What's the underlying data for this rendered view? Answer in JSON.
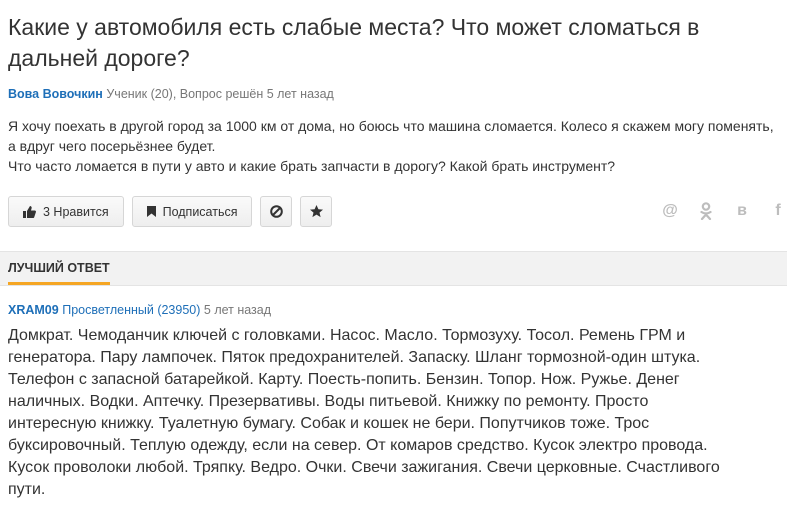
{
  "question": {
    "title": "Какие у автомобиля есть слабые места? Что может сломаться в дальней дороге?",
    "author": "Вова Вовочкин",
    "meta": "Ученик (20), Вопрос решён 5 лет назад",
    "body_line1": "Я хочу поехать в другой город за 1000 км от дома, но боюсь что машина сломается. Колесо я скажем могу поменять, а вдруг чего посерьёзнее будет.",
    "body_line2": "Что часто ломается в пути у авто и какие брать запчасти в дорогу? Какой брать инструмент?"
  },
  "actions": {
    "like_label": "3 Нравится",
    "subscribe_label": "Подписаться",
    "block_icon": "block-icon",
    "star_icon": "star-icon"
  },
  "share": {
    "icons": [
      "mail-ru-icon",
      "odnoklassniki-icon",
      "vk-icon",
      "facebook-icon"
    ]
  },
  "best_answer": {
    "label": "ЛУЧШИЙ ОТВЕТ",
    "author": "XRAM09",
    "rank": "Просветленный (23950)",
    "time": "5 лет назад",
    "body": "Домкрат. Чемоданчик ключей с головками. Насос. Масло. Тормозуху. Тосол. Ремень ГРМ и генератора. Пару лампочек. Пяток предохранителей. Запаску. Шланг тормозной-один штука. Телефон с запасной батарейкой. Карту. Поесть-попить. Бензин. Топор. Нож. Ружье. Денег наличных. Водки. Аптечку. Презервативы. Воды питьевой. Книжку по ремонту. Просто интересную книжку. Туалетную бумагу. Собак и кошек не бери. Попутчиков тоже. Трос буксировочный. Теплую одежду, если на север. От комаров средство. Кусок электро провода. Кусок проволоки любой. Тряпку. Ведро. Очки. Свечи зажигания. Свечи церковные. Счастливого пути."
  },
  "colors": {
    "link": "#1e6fb8",
    "accent": "#f5a623",
    "bar": "#f2f2f2"
  }
}
